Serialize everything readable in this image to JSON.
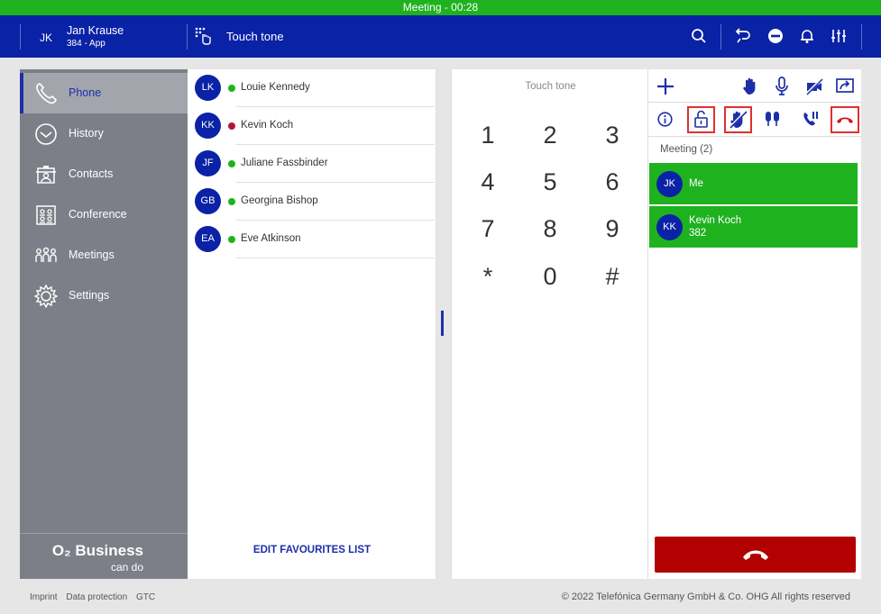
{
  "meeting_bar": {
    "text": "Meeting - 00:28"
  },
  "header": {
    "user_initials": "JK",
    "user_name": "Jan Krause",
    "user_ext": "384 - App",
    "title": "Touch tone",
    "icons": [
      "dialpad-icon",
      "search-icon",
      "redirect-icon",
      "do-not-disturb-icon",
      "bell-icon",
      "settings-sliders-icon"
    ]
  },
  "sidebar": {
    "items": [
      {
        "label": "Phone",
        "icon": "phone-icon",
        "active": true
      },
      {
        "label": "History",
        "icon": "clock-icon"
      },
      {
        "label": "Contacts",
        "icon": "contacts-icon"
      },
      {
        "label": "Conference",
        "icon": "conference-icon"
      },
      {
        "label": "Meetings",
        "icon": "meetings-icon"
      },
      {
        "label": "Settings",
        "icon": "gear-icon"
      }
    ],
    "brand_name": "O₂ Business",
    "brand_sub": "can do"
  },
  "favourites": {
    "items": [
      {
        "initials": "LK",
        "name": "Louie Kennedy",
        "status": "#1fb21f"
      },
      {
        "initials": "KK",
        "name": "Kevin Koch",
        "status": "#b0163a"
      },
      {
        "initials": "JF",
        "name": "Juliane Fassbinder",
        "status": "#1fb21f"
      },
      {
        "initials": "GB",
        "name": "Georgina Bishop",
        "status": "#1fb21f"
      },
      {
        "initials": "EA",
        "name": "Eve Atkinson",
        "status": "#1fb21f"
      }
    ],
    "edit_label": "EDIT FAVOURITES LIST"
  },
  "dialpad": {
    "title": "Touch tone",
    "keys": [
      "1",
      "2",
      "3",
      "4",
      "5",
      "6",
      "7",
      "8",
      "9",
      "*",
      "0",
      "#"
    ]
  },
  "meeting": {
    "label": "Meeting (2)",
    "participants": [
      {
        "initials": "JK",
        "name": "Me",
        "ext": ""
      },
      {
        "initials": "KK",
        "name": "Kevin Koch",
        "ext": "382"
      }
    ],
    "toolbar_top": [
      "add-icon",
      "raise-hand-icon",
      "microphone-icon",
      "video-off-icon",
      "share-icon"
    ],
    "toolbar_bottom": [
      "info-icon",
      "unlock-icon",
      "lower-hands-icon",
      "mute-all-icon",
      "hold-icon",
      "hangup-small-icon"
    ]
  },
  "footer": {
    "links": [
      "Imprint",
      "Data protection",
      "GTC"
    ],
    "copyright": "© 2022 Telefónica Germany GmbH & Co. OHG All rights reserved"
  },
  "colors": {
    "accent": "#0a22a6",
    "active_green": "#1fb21f",
    "hangup_red": "#b30000",
    "highlight": "#e03030"
  }
}
